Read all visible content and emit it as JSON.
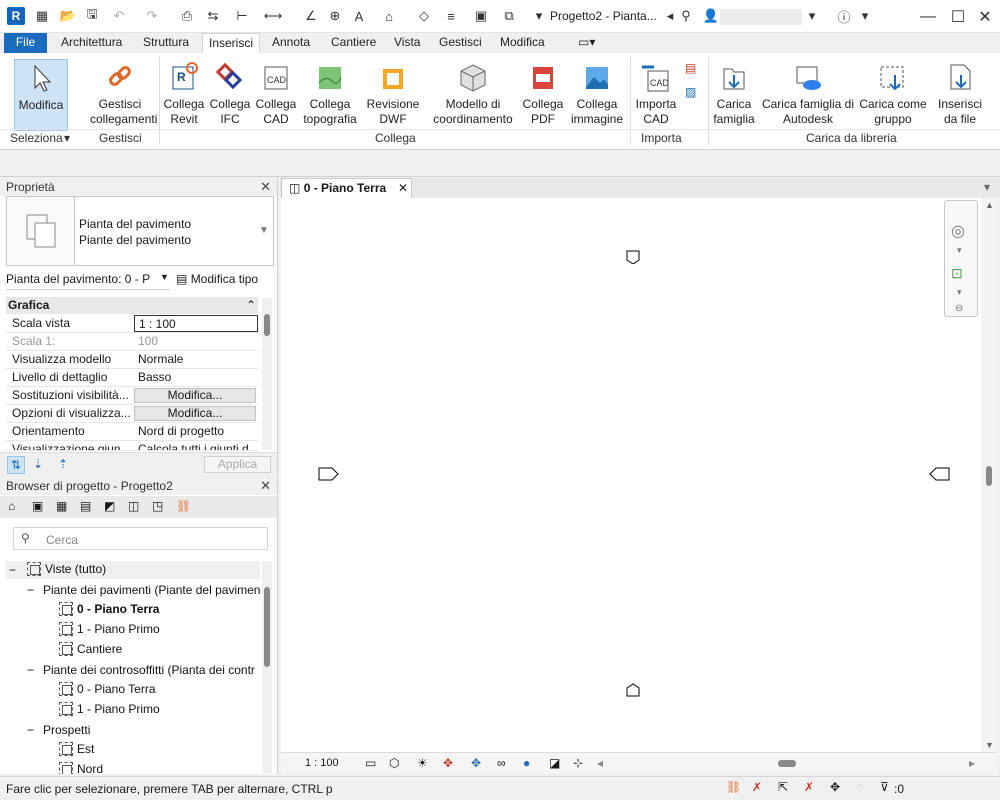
{
  "title": "Progetto2 - Pianta...",
  "menu": [
    "File",
    "Architettura",
    "Struttura",
    "Inserisci",
    "Annota",
    "Cantiere",
    "Vista",
    "Gestisci",
    "Modifica"
  ],
  "ribbon": {
    "buttons": [
      "Modifica",
      "Gestisci collegamenti",
      "Collega Revit",
      "Collega IFC",
      "Collega CAD",
      "Collega topografia",
      "Revisione DWF",
      "Modello di coordinamento",
      "Collega PDF",
      "Collega immagine",
      "Importa CAD",
      "Carica famiglia",
      "Carica famiglia di Autodesk",
      "Carica come gruppo",
      "Inserisci da file"
    ],
    "panels": [
      "Seleziona",
      "Gestisci",
      "Collega",
      "Importa",
      "Carica da libreria"
    ]
  },
  "properties": {
    "title": "Proprietà",
    "type_line1": "Pianta del pavimento",
    "type_line2": "Piante del pavimento",
    "selector": "Pianta del pavimento: 0 - P",
    "edit_type": "Modifica tipo",
    "section": "Grafica",
    "rows": [
      {
        "k": "Scala vista",
        "v": "1 : 100"
      },
      {
        "k": "Scala  1:",
        "v": "100"
      },
      {
        "k": "Visualizza modello",
        "v": "Normale"
      },
      {
        "k": "Livello di dettaglio",
        "v": "Basso"
      },
      {
        "k": "Sostituzioni visibilità...",
        "v": "Modifica..."
      },
      {
        "k": "Opzioni di visualizza...",
        "v": "Modifica..."
      },
      {
        "k": "Orientamento",
        "v": "Nord di progetto"
      },
      {
        "k": "Visualizzazione giun...",
        "v": "Calcola tutti i giunti d..."
      }
    ],
    "apply": "Applica"
  },
  "browser": {
    "title": "Browser di progetto - Progetto2",
    "search_placeholder": "Cerca",
    "tree": [
      "Viste (tutto)",
      "Piante dei pavimenti (Piante del pavimen",
      "0 - Piano Terra",
      "1 - Piano Primo",
      "Cantiere",
      "Piante dei controsoffitti (Pianta dei contr",
      "0 - Piano Terra",
      "1 - Piano Primo",
      "Prospetti",
      "Est",
      "Nord"
    ]
  },
  "view_tab": "0 - Piano Terra",
  "viewbar": {
    "scale": "1 : 100"
  },
  "status": {
    "text": "Fare clic per selezionare, premere TAB per alternare, CTRL p",
    "filter_count": ":0"
  },
  "colors": {
    "accent": "#1b6bbd",
    "selected": "#cfe3f7"
  }
}
